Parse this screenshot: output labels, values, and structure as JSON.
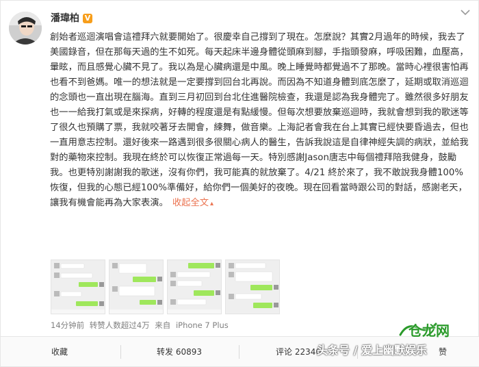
{
  "post": {
    "username": "潘瑋柏",
    "badge": "V",
    "text": "創始者巡迴演唱會這禮拜六就要開始了。很慶幸自己撐到了現在。怎麼說？其實2月過年的時候，我去了美國錄音，但在那每天過的生不如死。每天起床半邊身體從頭麻到腳，手指頭發麻，呼吸困難，血壓高，暈眩，而且感覺心臟不見了。我以為是心臟病還是中風。晚上睡覺時都覺過不了那晚。當時心裡很害怕再也看不到爸媽。唯一的想法就是一定要撐到回台北再說。而因為不知道身體到底怎麼了，延期或取消巡迴的念頭也一直出現在腦海。直到三月初回到台北住進醫院檢查，我還是認為我身體完了。雖然很多好朋友也一一給我打氣或是來探病，好轉的程度還是有點緩慢。但每次想要放棄巡迴時，我就會想到我的歌迷等了很久也預購了票，我就咬著牙去開會，練舞，做音樂。上海記者會我在台上其實已經快要昏過去，但也一直用意志控制。還好後來一路遇到很多很關心病人的醫生，告訴我說這是自律神經失調的病狀，並給我對的藥物來控制。我現在終於可以恢復正常過每一天。特別感謝Jason唐志中每個禮拜陪我健身，鼓勵我。也更特別謝謝我的歌迷，沒有你們，我可能真的就放棄了。4/21 終於來了，我不敢說我身體100% 恢復，但我的心態已經100%準備好，給你們一個美好的夜晚。現在回看當時跟公司的對話，感謝老天，讓我有機會能再為大家表演。",
    "collapse_label": "收起全文",
    "meta": {
      "time": "14分钟前",
      "reposts_note": "转赞人数超过4万",
      "source_prefix": "来自",
      "device": "iPhone 7 Plus"
    }
  },
  "actions": {
    "favorite": "收藏",
    "repost": "转发 60893",
    "comment": "评论 22340",
    "like": "赞"
  },
  "watermark": {
    "text": "头条号 / 爱上幽默娱乐",
    "logo": "仓龙网"
  },
  "colors": {
    "link": "#eb7350",
    "badge": "#f79e1b",
    "chat_green": "#9fe75c"
  }
}
